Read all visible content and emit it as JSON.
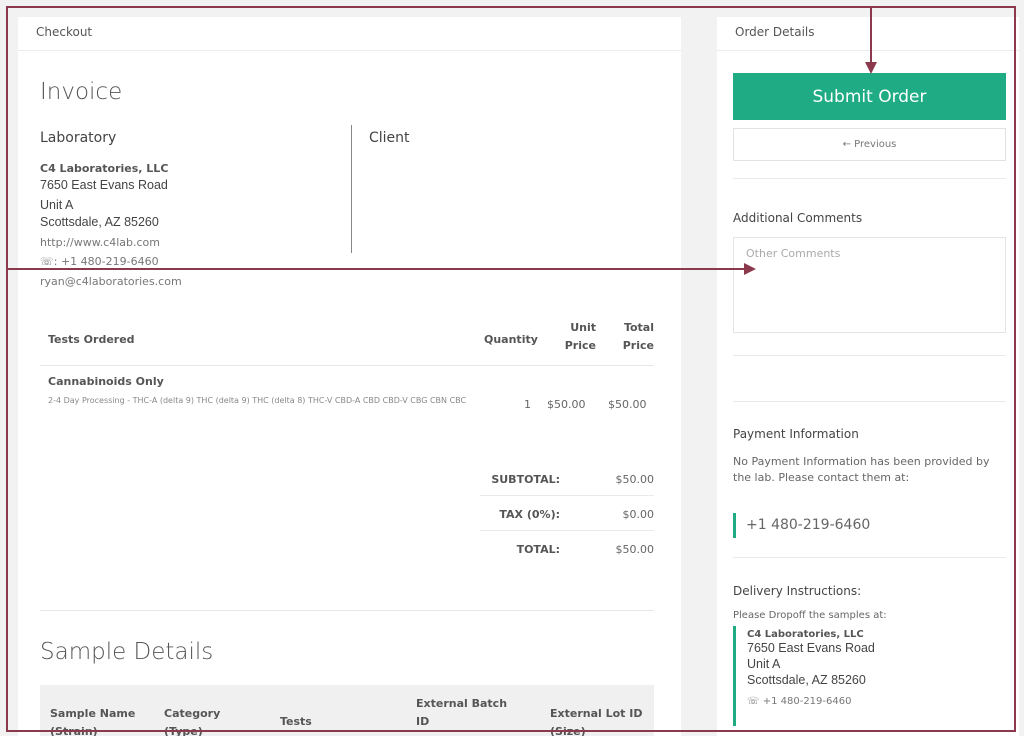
{
  "left_panel": {
    "header": "Checkout"
  },
  "right_panel": {
    "header": "Order Details"
  },
  "invoice": {
    "title": "Invoice",
    "laboratory_heading": "Laboratory",
    "client_heading": "Client",
    "lab": {
      "name": "C4 Laboratories, LLC",
      "address_line1": "7650 East Evans Road",
      "address_line2": "Unit A",
      "address_line3": "Scottsdale, AZ 85260",
      "website": "http://www.c4lab.com",
      "phone": "+1 480-219-6460",
      "email": "ryan@c4laboratories.com"
    },
    "table": {
      "headers": {
        "tests": "Tests Ordered",
        "quantity": "Quantity",
        "unit_price": "Unit Price",
        "total_price": "Total Price"
      },
      "rows": [
        {
          "name": "Cannabinoids Only",
          "description": "2-4 Day Processing - THC-A (delta 9) THC (delta 9) THC (delta 8) THC-V CBD-A CBD CBD-V CBG CBN CBC",
          "quantity": "1",
          "unit_price": "$50.00",
          "total_price": "$50.00"
        }
      ]
    },
    "summary": {
      "subtotal_label": "SUBTOTAL:",
      "subtotal": "$50.00",
      "tax_label": "TAX (0%):",
      "tax": "$0.00",
      "total_label": "TOTAL:",
      "total": "$50.00"
    }
  },
  "sample_details": {
    "title": "Sample Details",
    "headers": [
      "Sample Name (Strain)",
      "Category (Type)",
      "Tests",
      "External Batch ID",
      "External Lot ID (Size)"
    ]
  },
  "order": {
    "submit_label": "Submit Order",
    "previous_label": "← Previous",
    "comments_heading": "Additional Comments",
    "comments_placeholder": "Other Comments",
    "payment_heading": "Payment Information",
    "payment_text": "No Payment Information has been provided by the lab. Please contact them at:",
    "payment_phone": "+1 480-219-6460",
    "delivery_heading": "Delivery Instructions:",
    "delivery_text": "Please Dropoff the samples at:",
    "delivery": {
      "name": "C4 Laboratories, LLC",
      "address_line1": "7650 East Evans Road",
      "address_line2": "Unit A",
      "address_line3": "Scottsdale, AZ 85260",
      "phone": "+1 480-219-6460"
    }
  },
  "colors": {
    "accent": "#1fac84",
    "annotation": "#8b3a4e"
  },
  "icons": {
    "phone": "phone-icon",
    "previous": "arrow-left-icon"
  }
}
